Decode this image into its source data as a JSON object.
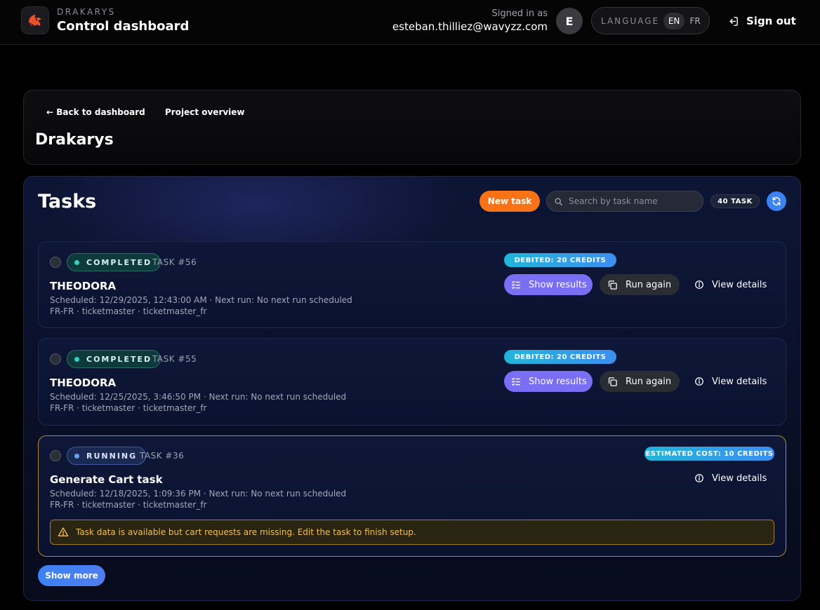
{
  "header": {
    "brand_sub": "DRAKARYS",
    "brand_title": "Control dashboard",
    "signed_in_label": "Signed in as",
    "email": "esteban.thilliez@wavyzz.com",
    "avatar_initial": "E",
    "language_label": "LANGUAGE",
    "languages": [
      "EN",
      "FR"
    ],
    "active_language": "EN",
    "sign_out": "Sign out"
  },
  "project": {
    "back_link": "← Back to dashboard",
    "overview_link": "Project overview",
    "title": "Drakarys"
  },
  "tasks": {
    "title": "Tasks",
    "new_task": "New task",
    "search_placeholder": "Search by task name",
    "count_badge": "40 TASK",
    "show_more": "Show more",
    "items": [
      {
        "status": "COMPLETED",
        "id": "TASK #56",
        "name": "THEODORA",
        "schedule": "Scheduled: 12/29/2025, 12:43:00 AM · Next run: No next run scheduled",
        "tags": "FR-FR · ticketmaster · ticketmaster_fr",
        "credits": "DEBITED: 20 CREDITS",
        "show_results": "Show results",
        "run_again": "Run again",
        "view_details": "View details"
      },
      {
        "status": "COMPLETED",
        "id": "TASK #55",
        "name": "THEODORA",
        "schedule": "Scheduled: 12/25/2025, 3:46:50 PM · Next run: No next run scheduled",
        "tags": "FR-FR · ticketmaster · ticketmaster_fr",
        "credits": "DEBITED: 20 CREDITS",
        "show_results": "Show results",
        "run_again": "Run again",
        "view_details": "View details"
      },
      {
        "status": "RUNNING",
        "id": "TASK #36",
        "name": "Generate Cart task",
        "schedule": "Scheduled: 12/18/2025, 1:09:36 PM · Next run: No next run scheduled",
        "tags": "FR-FR · ticketmaster · ticketmaster_fr",
        "credits": "ESTIMATED COST: 10 CREDITS",
        "view_details": "View details",
        "warning": "Task data is available but cart requests are missing. Edit the task to finish setup."
      }
    ]
  },
  "colors": {
    "accent_orange": "#f97316",
    "accent_blue": "#3b82f6",
    "results_purple": "#7a6ef5",
    "warning_yellow": "#f2c14e"
  },
  "icons": {
    "logo": "dragon-logo-icon",
    "sign_out": "sign-out-icon",
    "search": "search-icon",
    "refresh": "refresh-icon",
    "results": "list-check-icon",
    "run_again": "copy-icon",
    "details": "info-icon",
    "warning": "warning-icon"
  }
}
